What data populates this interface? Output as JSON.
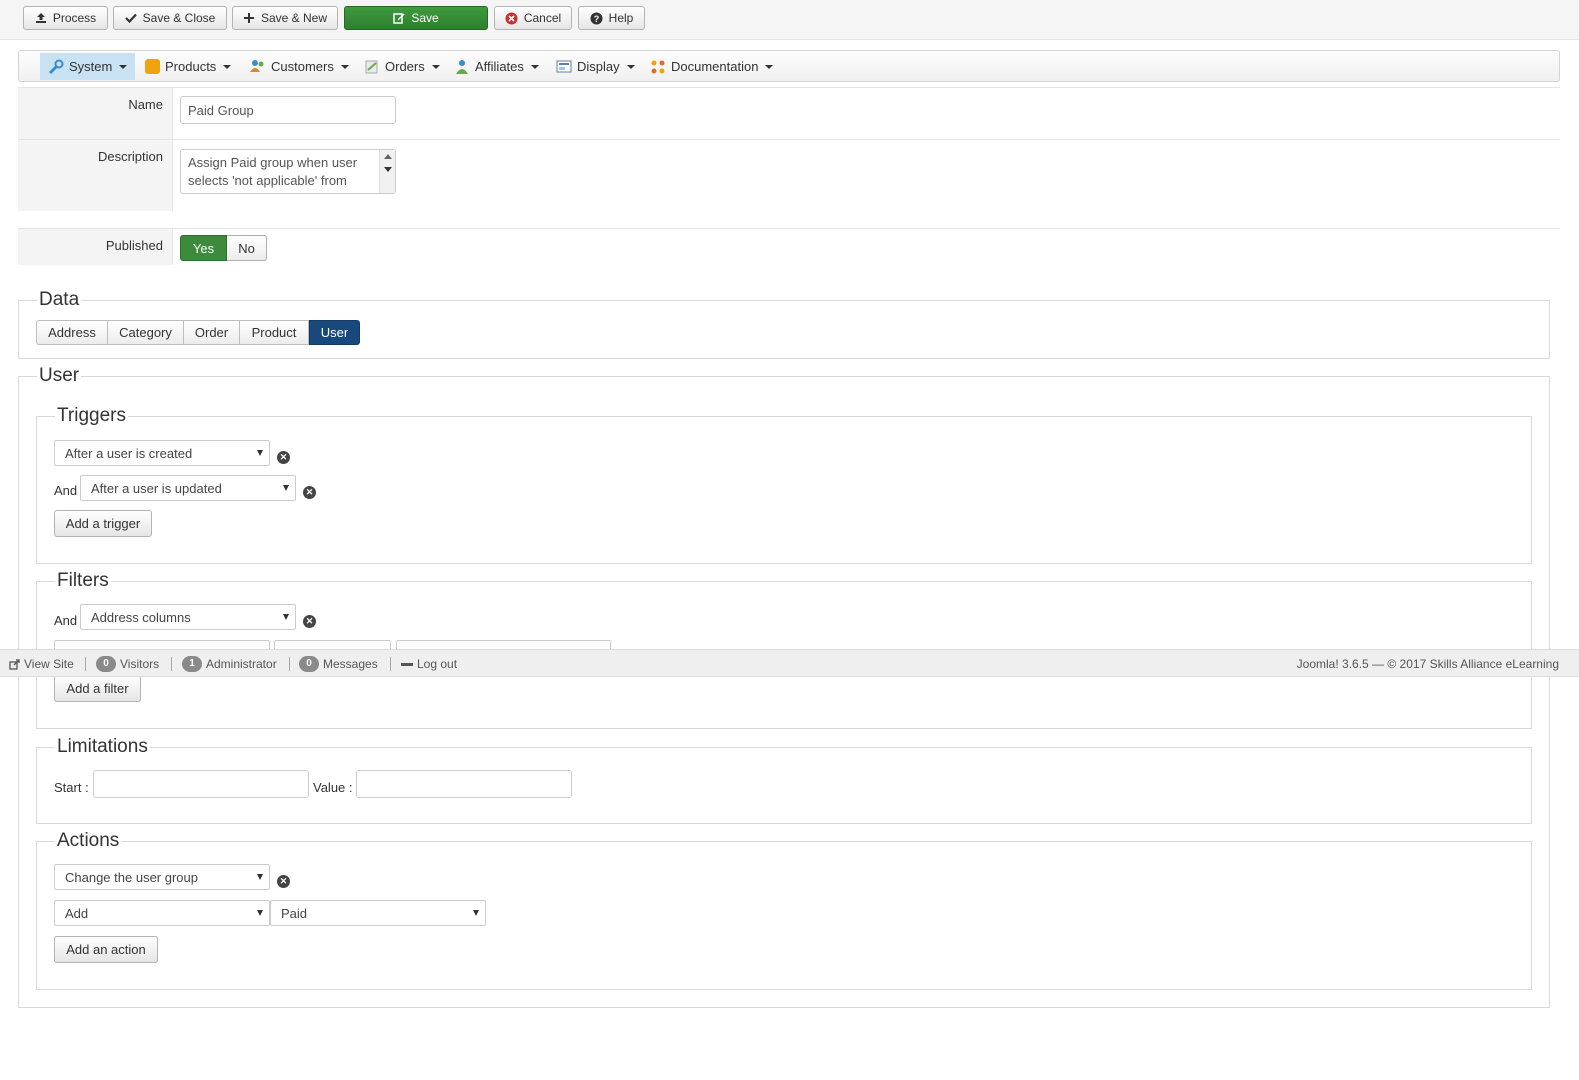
{
  "toolbar": {
    "process": "Process",
    "save_close": "Save & Close",
    "save_new": "Save & New",
    "save": "Save",
    "cancel": "Cancel",
    "help": "Help"
  },
  "menu": {
    "system": "System",
    "products": "Products",
    "customers": "Customers",
    "orders": "Orders",
    "affiliates": "Affiliates",
    "display": "Display",
    "documentation": "Documentation"
  },
  "form": {
    "name_label": "Name",
    "name_value": "Paid Group",
    "description_label": "Description",
    "description_value": "Assign Paid group when user selects 'not applicable' from company drop down in checkout",
    "published_label": "Published",
    "published_yes": "Yes",
    "published_no": "No"
  },
  "data_section": {
    "legend": "Data",
    "tabs": [
      "Address",
      "Category",
      "Order",
      "Product",
      "User"
    ],
    "active_tab": "User"
  },
  "user_section": {
    "legend": "User",
    "triggers": {
      "legend": "Triggers",
      "trigger1": "After a user is created",
      "and_label": "And",
      "trigger2": "After a user is updated",
      "add_button": "Add a trigger"
    },
    "filters": {
      "legend": "Filters",
      "and_label": "And",
      "filter1": "Address columns",
      "add_button": "Add a filter"
    },
    "limitations": {
      "legend": "Limitations",
      "start_label": "Start :",
      "value_label": "Value :",
      "start_value": "",
      "value_value": ""
    },
    "actions": {
      "legend": "Actions",
      "action1": "Change the user group",
      "mode": "Add",
      "group": "Paid",
      "add_button": "Add an action"
    }
  },
  "statusbar": {
    "view_site": "View Site",
    "visitors_count": "0",
    "visitors": "Visitors",
    "admin_count": "1",
    "admin": "Administrator",
    "messages_count": "0",
    "messages": "Messages",
    "logout": "Log out",
    "footer": "Joomla! 3.6.5  —  © 2017 Skills Alliance eLearning"
  },
  "colors": {
    "save_green": "#348c34",
    "active_tab": "#17497c",
    "menu_active": "#c8e1f3"
  }
}
